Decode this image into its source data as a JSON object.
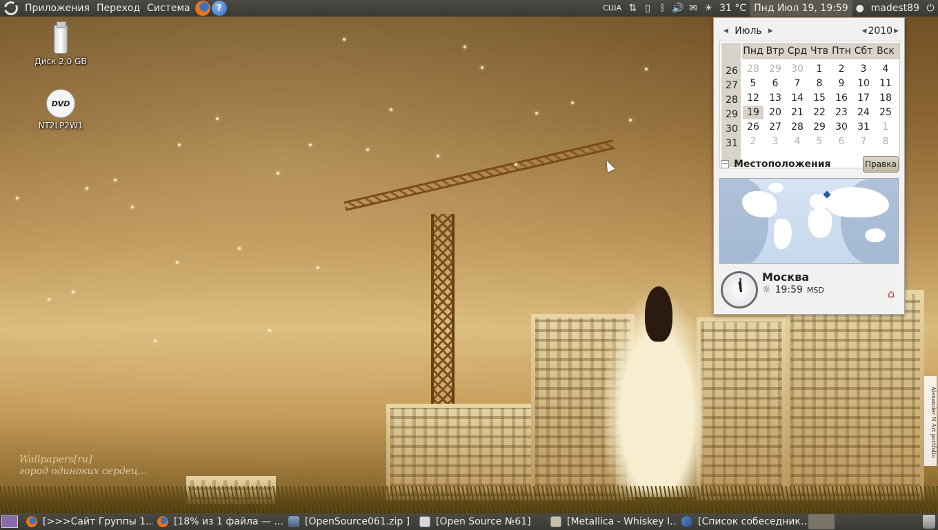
{
  "top_panel": {
    "menus": [
      "Приложения",
      "Переход",
      "Система"
    ],
    "tray": {
      "keyboard_layout": "США",
      "weather_temp": "31 °C",
      "clock": "Пнд Июл 19, 19:59",
      "user": "madest89"
    }
  },
  "desktop": {
    "icons": [
      {
        "label": "Диск 2,0 GB"
      },
      {
        "label": "NT2LP2W1",
        "badge": "DVD"
      }
    ],
    "wallpaper": {
      "watermark_line1": "Wallpapers[ru]",
      "watermark_line2": "город одиноких сердец...",
      "credit": "Alexander N Art portfolio"
    }
  },
  "calendar": {
    "month": "Июль",
    "year": "2010",
    "weekdays": [
      "Пнд",
      "Втр",
      "Срд",
      "Чтв",
      "Птн",
      "Сбт",
      "Вск"
    ],
    "weeks": [
      {
        "week": "26",
        "days": [
          "28",
          "29",
          "30",
          "1",
          "2",
          "3",
          "4"
        ]
      },
      {
        "week": "27",
        "days": [
          "5",
          "6",
          "7",
          "8",
          "9",
          "10",
          "11"
        ]
      },
      {
        "week": "28",
        "days": [
          "12",
          "13",
          "14",
          "15",
          "16",
          "17",
          "18"
        ]
      },
      {
        "week": "29",
        "days": [
          "19",
          "20",
          "21",
          "22",
          "23",
          "24",
          "25"
        ]
      },
      {
        "week": "30",
        "days": [
          "26",
          "27",
          "28",
          "29",
          "30",
          "31",
          "1"
        ]
      },
      {
        "week": "31",
        "days": [
          "2",
          "3",
          "4",
          "5",
          "6",
          "7",
          "8"
        ]
      }
    ],
    "today": "19",
    "locations_title": "Местоположения",
    "edit_button": "Правка",
    "location": {
      "city": "Москва",
      "time": "19:59",
      "timezone": "MSD"
    }
  },
  "taskbar": {
    "tasks": [
      {
        "label": "[>>>Сайт Группы 1...",
        "icon": "firefox-icon"
      },
      {
        "label": "[18% из 1 файла — ...",
        "icon": "firefox-icon"
      },
      {
        "label": "[OpenSource061.zip ]",
        "icon": "archive-icon"
      },
      {
        "label": "[Open Source №61]",
        "icon": "document-icon"
      },
      {
        "label": "[Metallica - Whiskey I...",
        "icon": "music-icon"
      },
      {
        "label": "[Список собеседник...",
        "icon": "chat-icon"
      }
    ]
  },
  "colors": {
    "panel": "#3d3c37",
    "panel_text": "#f0ede8",
    "calendar_bg": "#f2f1ef",
    "week_header": "#d8d2c8"
  }
}
